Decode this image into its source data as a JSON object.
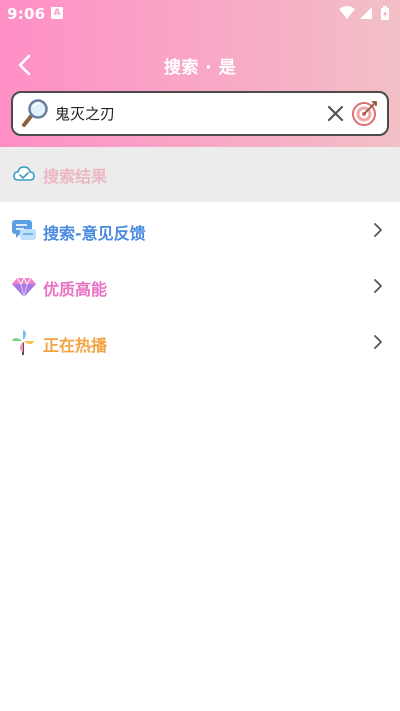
{
  "status_bar": {
    "time": "9:06",
    "notification_badge": "A",
    "icons": [
      "wifi-icon",
      "signal-icon",
      "battery-charging-icon"
    ]
  },
  "nav": {
    "title": "搜索 · 是",
    "back_icon": "chevron-left-icon"
  },
  "search": {
    "value": "鬼灭之刃",
    "placeholder": "",
    "left_icon": "magnifier-icon",
    "clear_icon": "close-icon",
    "action_icon": "target-icon"
  },
  "results": {
    "header_label": "搜索结果",
    "header_icon": "cloud-check-icon",
    "items": [
      {
        "label": "搜索-意见反馈",
        "icon": "feedback-chat-icon",
        "color": "#4a8be0"
      },
      {
        "label": "优质高能",
        "icon": "diamond-icon",
        "color": "#ea72c4"
      },
      {
        "label": "正在热播",
        "icon": "pinwheel-icon",
        "color": "#f3a443"
      }
    ]
  },
  "colors": {
    "header_gradient_start": "#ff8fc6",
    "header_gradient_end": "#f2c0c6",
    "results_header_bg": "#ececec",
    "results_header_text": "#ecb8c4"
  }
}
